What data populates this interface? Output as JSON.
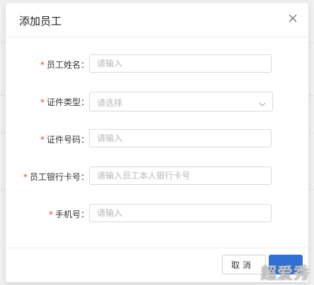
{
  "dialog": {
    "title": "添加员工",
    "close_icon": "close-icon"
  },
  "form": {
    "fields": [
      {
        "label": "员工姓名：",
        "required": "*",
        "placeholder": "请输入",
        "type": "text"
      },
      {
        "label": "证件类型：",
        "required": "*",
        "placeholder": "请选择",
        "type": "select"
      },
      {
        "label": "证件号码：",
        "required": "*",
        "placeholder": "请输入",
        "type": "text"
      },
      {
        "label": "员工银行卡号：",
        "required": "*",
        "placeholder": "请输入员工本人银行卡号",
        "type": "text"
      },
      {
        "label": "手机号：",
        "required": "*",
        "placeholder": "请输入",
        "type": "text"
      }
    ]
  },
  "footer": {
    "cancel_label": "取 消"
  },
  "watermark": "超爱秀",
  "colors": {
    "required": "#e04a3a",
    "primary": "#2f6fd6",
    "border": "#d9d9d9"
  }
}
